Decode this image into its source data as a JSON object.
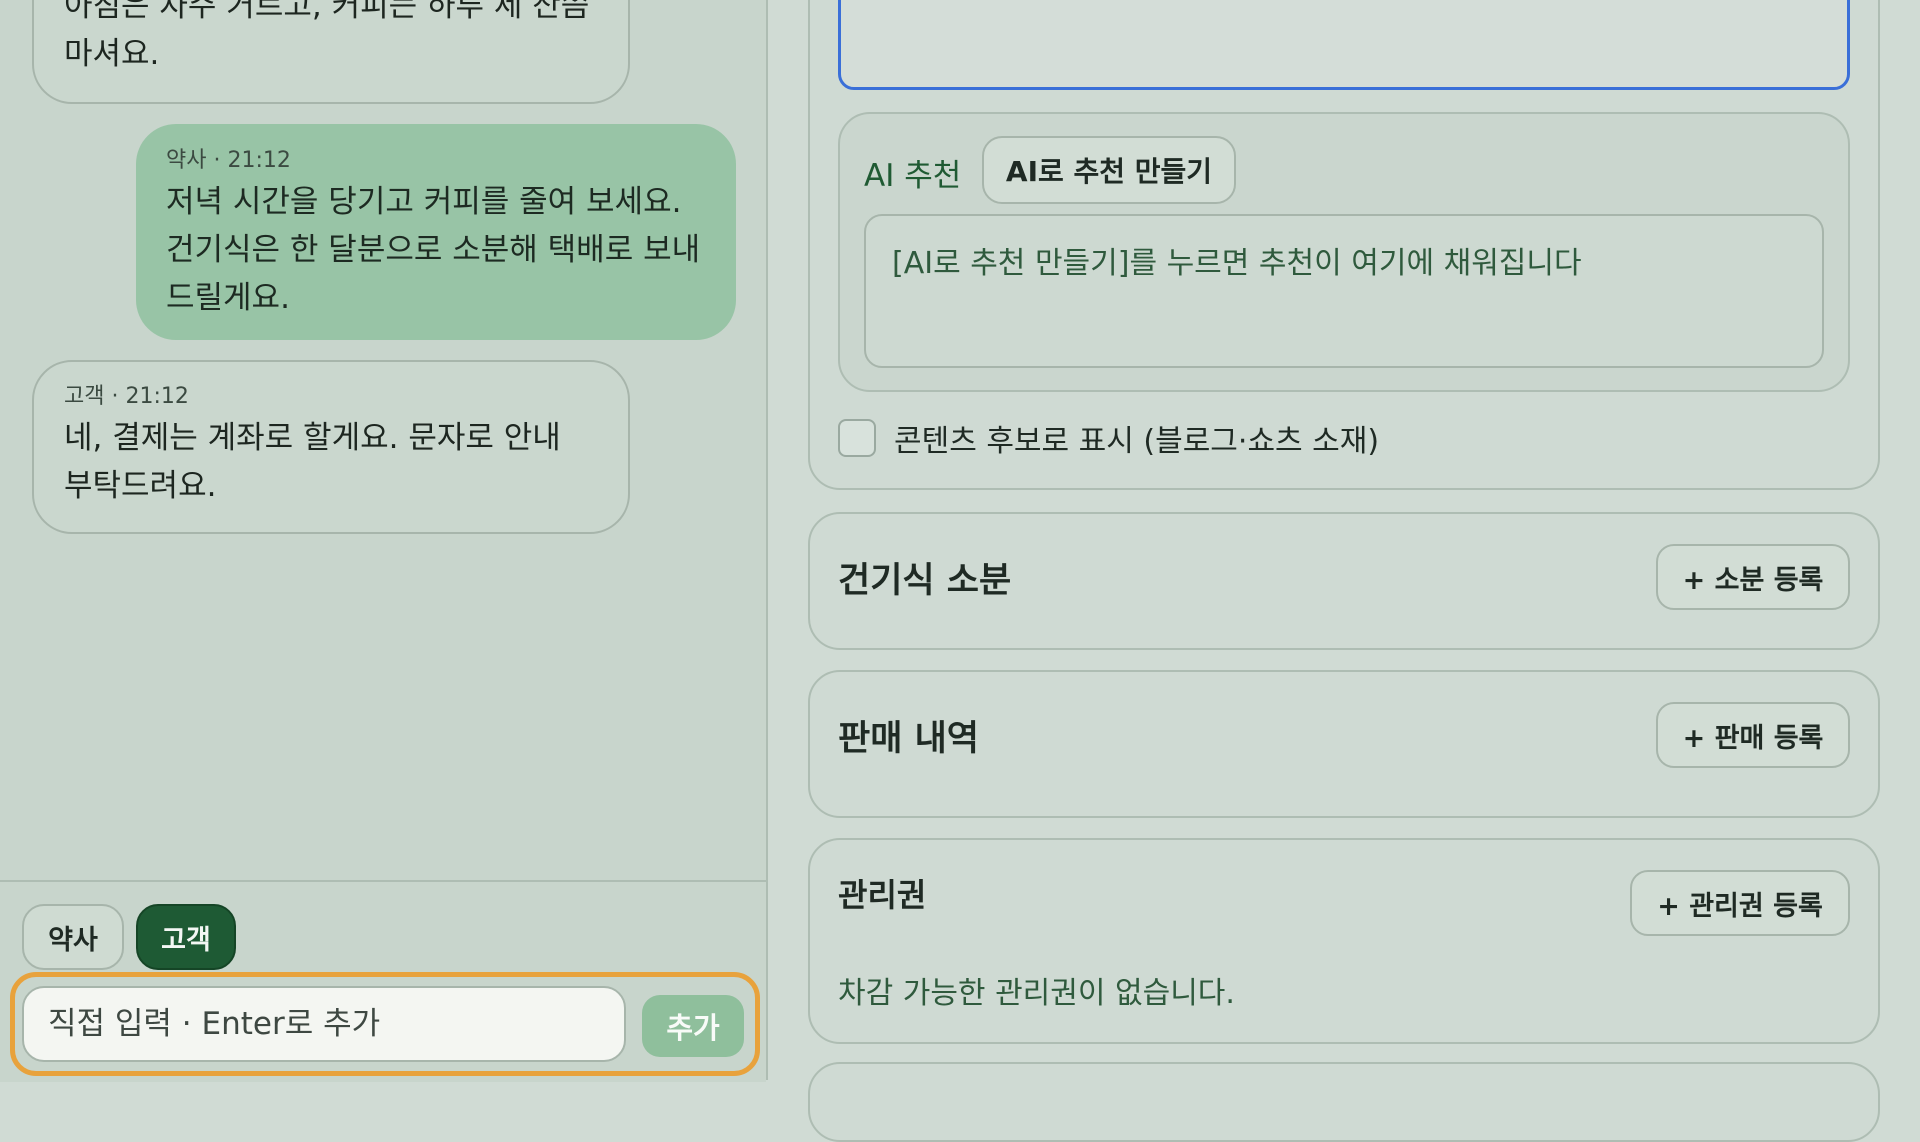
{
  "chat": {
    "messages": [
      {
        "sender": "",
        "time": "",
        "text": "아침은 자주 거르고, 커피는 하루 세 잔쯤\n마셔요."
      },
      {
        "sender": "약사",
        "time": "21:12",
        "meta": "약사 · 21:12",
        "text": "저녁 시간을 당기고 커피를 줄여 보세요.\n건기식은 한 달분으로 소분해 택배로 보내\n드릴게요."
      },
      {
        "sender": "고객",
        "time": "21:12",
        "meta": "고객 · 21:12",
        "text": "네, 결제는 계좌로 할게요. 문자로 안내\n부탁드려요."
      }
    ],
    "role_buttons": {
      "pharmacist": "약사",
      "customer": "고객",
      "selected": "고객"
    },
    "composer": {
      "placeholder": "직접 입력 · Enter로 추가",
      "value": "",
      "send_label": "추가"
    }
  },
  "ai": {
    "label": "AI 추천",
    "make_button": "AI로 추천 만들기",
    "output_placeholder": "[AI로 추천 만들기]를 누르면 추천이 여기에 채워집니다"
  },
  "content_candidate": {
    "label": "콘텐츠 후보로 표시 (블로그·쇼츠 소재)",
    "checked": false
  },
  "sections": {
    "supplement": {
      "title": "건기식 소분",
      "button": "+ 소분 등록"
    },
    "sales": {
      "title": "판매 내역",
      "button": "+ 판매 등록"
    },
    "management": {
      "title": "관리권",
      "button": "+ 관리권 등록",
      "empty": "차감 가능한 관리권이 없습니다."
    }
  },
  "colors": {
    "accent_green": "#1e5a34",
    "focus_outline": "#e8a23c",
    "input_focus": "#3a6fd8"
  }
}
